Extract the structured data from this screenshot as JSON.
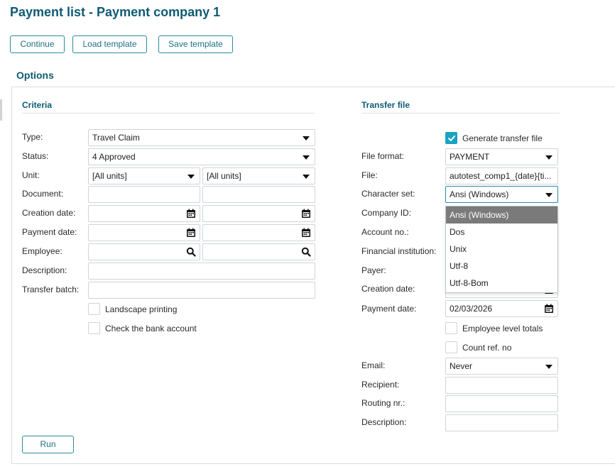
{
  "page": {
    "title": "Payment list - Payment company 1"
  },
  "toolbar": {
    "continue_label": "Continue",
    "load_template_label": "Load template",
    "save_template_label": "Save template"
  },
  "options": {
    "title": "Options"
  },
  "criteria": {
    "title": "Criteria",
    "type": {
      "label": "Type:",
      "value": "Travel Claim"
    },
    "status": {
      "label": "Status:",
      "value": "4 Approved"
    },
    "unit": {
      "label": "Unit:",
      "value_from": "[All units]",
      "value_to": "[All units]"
    },
    "document": {
      "label": "Document:",
      "value_from": "",
      "value_to": ""
    },
    "creation_date": {
      "label": "Creation date:",
      "value_from": "",
      "value_to": ""
    },
    "payment_date": {
      "label": "Payment date:",
      "value_from": "",
      "value_to": ""
    },
    "employee": {
      "label": "Employee:",
      "value_from": "",
      "value_to": ""
    },
    "description": {
      "label": "Description:",
      "value": ""
    },
    "transfer_batch": {
      "label": "Transfer batch:",
      "value": ""
    },
    "landscape_printing": {
      "label": "Landscape printing",
      "checked": false
    },
    "check_bank_account": {
      "label": "Check the bank account",
      "checked": false
    }
  },
  "transfer": {
    "title": "Transfer file",
    "generate": {
      "label": "Generate transfer file",
      "checked": true
    },
    "file_format": {
      "label": "File format:",
      "value": "PAYMENT"
    },
    "file": {
      "label": "File:",
      "value": "autotest_comp1_{date}{ti..."
    },
    "character_set": {
      "label": "Character set:",
      "value": "Ansi (Windows)",
      "options": [
        "Ansi (Windows)",
        "Dos",
        "Unix",
        "Utf-8",
        "Utf-8-Bom"
      ]
    },
    "company_id": {
      "label": "Company ID:"
    },
    "account_no": {
      "label": "Account no.:"
    },
    "financial_institution": {
      "label": "Financial institution:"
    },
    "payer": {
      "label": "Payer:"
    },
    "creation_date": {
      "label": "Creation date:"
    },
    "payment_date": {
      "label": "Payment date:",
      "value": "02/03/2026"
    },
    "employee_level_totals": {
      "label": "Employee level totals",
      "checked": false
    },
    "count_ref_no": {
      "label": "Count ref. no",
      "checked": false
    },
    "email": {
      "label": "Email:",
      "value": "Never"
    },
    "recipient": {
      "label": "Recipient:",
      "value": ""
    },
    "routing_nr": {
      "label": "Routing nr.:",
      "value": ""
    },
    "description": {
      "label": "Description:",
      "value": ""
    }
  },
  "run_label": "Run",
  "icons": {
    "calendar": "calendar-icon",
    "search": "search-icon",
    "dropdown": "chevron-down-icon",
    "check": "check-icon"
  },
  "colors": {
    "accent": "#0e5b72",
    "button_border": "#2b8aa0",
    "checkbox_checked": "#19a3c2",
    "dropdown_selected": "#7a7a7a"
  }
}
